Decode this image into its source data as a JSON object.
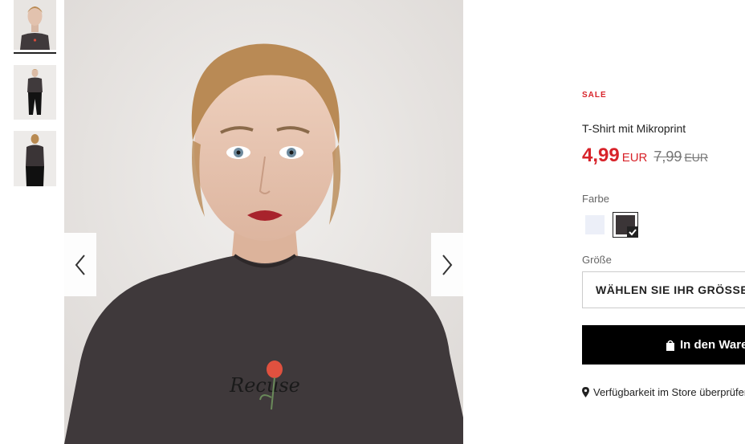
{
  "gallery": {
    "thumbnails": [
      {
        "alt": "model-front-closeup"
      },
      {
        "alt": "model-full-body"
      },
      {
        "alt": "model-back-view"
      }
    ],
    "prev_icon": "chevron-left-icon",
    "next_icon": "chevron-right-icon"
  },
  "product": {
    "badge": "SALE",
    "title": "T-Shirt mit Mikroprint",
    "price": "4,99",
    "currency": "EUR",
    "old_price": "7,99",
    "old_currency": "EUR",
    "color_label": "Farbe",
    "colors": [
      {
        "name": "light-lavender",
        "hex": "#eceff8",
        "selected": false
      },
      {
        "name": "dark-grey",
        "hex": "#3b3537",
        "selected": true
      }
    ],
    "size_label": "Größe",
    "size_placeholder": "WÄHLEN SIE IHR GRÖSSE",
    "cart_label": "In den Warenkorb",
    "store_check": "Verfügbarkeit im Store überprüfen"
  },
  "colors": {
    "sale_red": "#d8232a",
    "button_black": "#000000"
  }
}
